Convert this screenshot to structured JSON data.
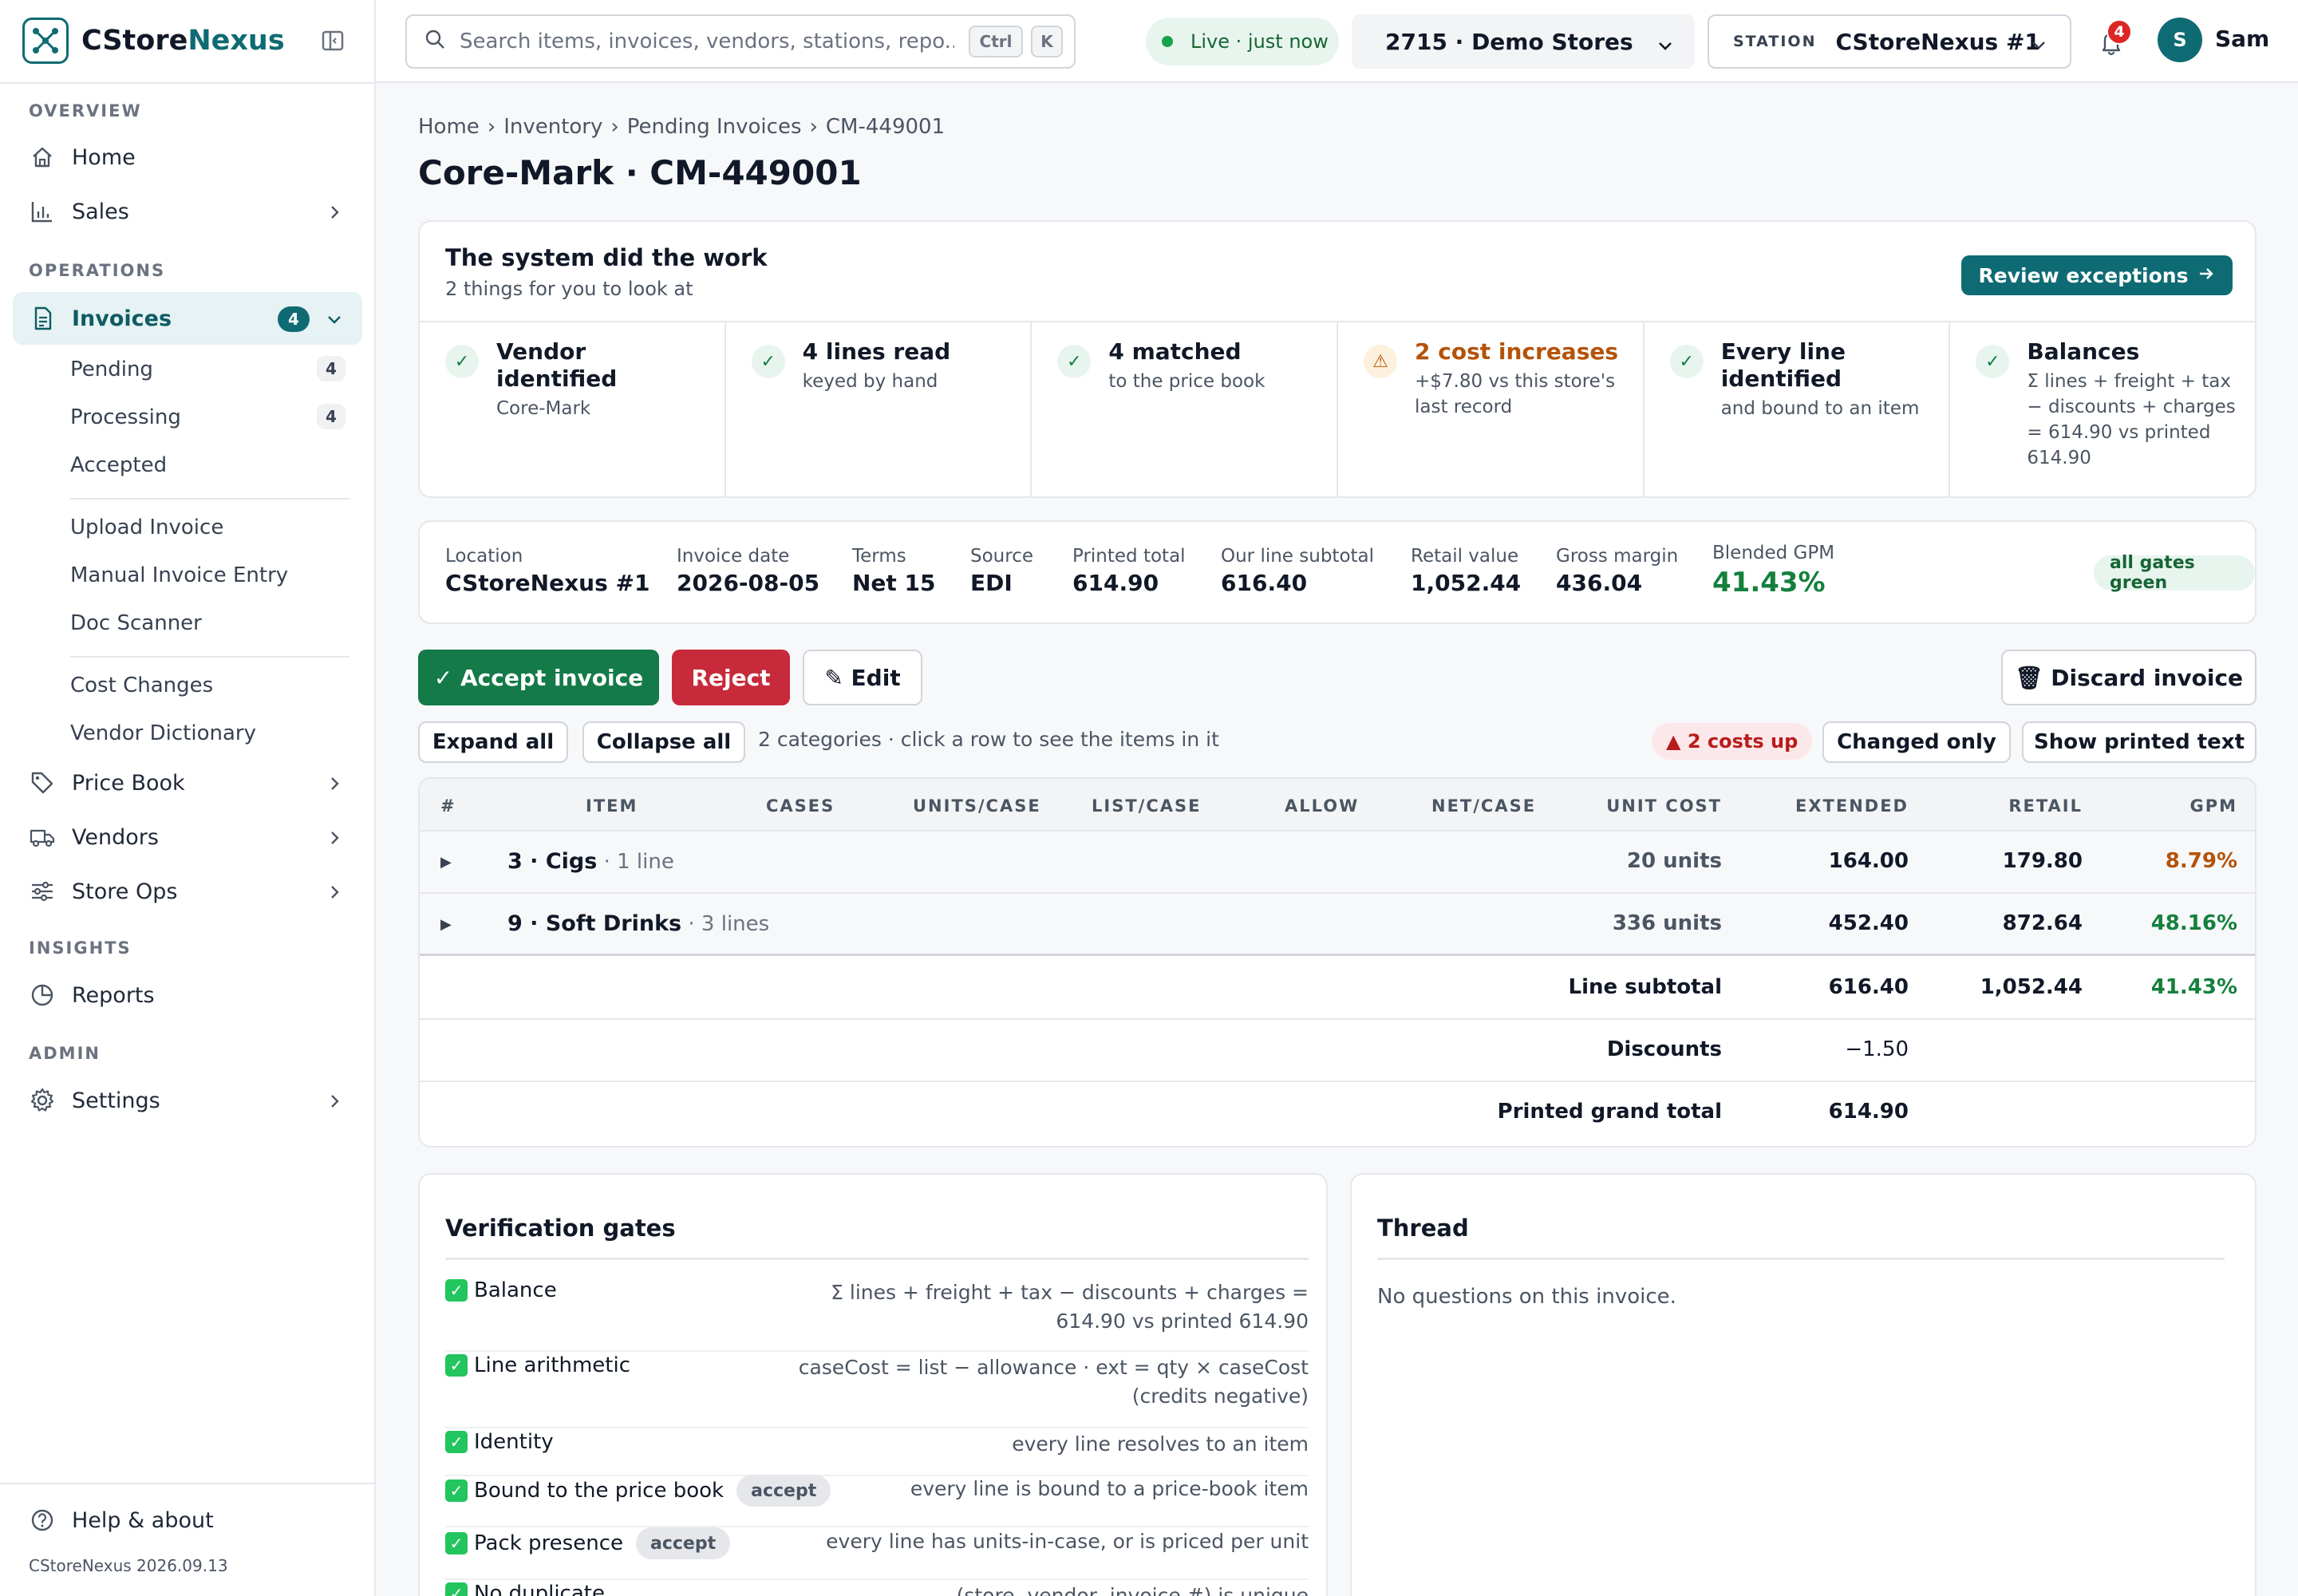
{
  "app": {
    "brand_prefix": "CStore",
    "brand_accent": "Nexus",
    "version": "CStoreNexus 2026.09.13"
  },
  "sidebar": {
    "sections": {
      "overview": "OVERVIEW",
      "operations": "OPERATIONS",
      "insights": "INSIGHTS",
      "admin": "ADMIN"
    },
    "items": {
      "home": "Home",
      "sales": "Sales",
      "invoices": "Invoices",
      "invoices_badge": "4",
      "price_book": "Price Book",
      "vendors": "Vendors",
      "store_ops": "Store Ops",
      "reports": "Reports",
      "settings": "Settings",
      "help": "Help & about"
    },
    "invoice_sub": {
      "pending": "Pending",
      "pending_badge": "4",
      "processing": "Processing",
      "processing_badge": "4",
      "accepted": "Accepted",
      "upload": "Upload Invoice",
      "manual": "Manual Invoice Entry",
      "scanner": "Doc Scanner",
      "cost_changes": "Cost Changes",
      "vendor_dictionary": "Vendor Dictionary"
    }
  },
  "topbar": {
    "search_placeholder": "Search items, invoices, vendors, stations, repo...",
    "kbd_ctrl": "Ctrl",
    "kbd_k": "K",
    "live": "Live · just now",
    "store": "2715 · Demo Stores",
    "station_tag": "STATION",
    "station": "CStoreNexus #1",
    "notifications": "4",
    "avatar_initial": "S",
    "user": "Sam"
  },
  "breadcrumb": [
    "Home",
    "›",
    "Inventory",
    "›",
    "Pending Invoices",
    "›",
    "CM-449001"
  ],
  "page_title": "Core-Mark · CM-449001",
  "summary": {
    "title": "The system did the work",
    "subtitle": "2 things for you to look at",
    "review_button": "Review exceptions",
    "tiles": [
      {
        "title": "Vendor identified",
        "sub": "Core-Mark",
        "status": "ok"
      },
      {
        "title": "4 lines read",
        "sub": "keyed by hand",
        "status": "ok"
      },
      {
        "title": "4 matched",
        "sub": "to the price book",
        "status": "ok"
      },
      {
        "title": "2 cost increases",
        "sub": "+$7.80 vs this store's last record",
        "status": "warn"
      },
      {
        "title": "Every line identified",
        "sub": "and bound to an item",
        "status": "ok"
      },
      {
        "title": "Balances",
        "sub": "Σ lines + freight + tax − discounts + charges = 614.90 vs printed 614.90",
        "status": "ok"
      }
    ]
  },
  "meta": {
    "location_label": "Location",
    "location": "CStoreNexus #1",
    "date_label": "Invoice date",
    "date": "2026-08-05",
    "terms_label": "Terms",
    "terms": "Net 15",
    "source_label": "Source",
    "source": "EDI",
    "printed_label": "Printed total",
    "printed": "614.90",
    "subtotal_label": "Our line subtotal",
    "subtotal": "616.40",
    "retail_label": "Retail value",
    "retail": "1,052.44",
    "margin_label": "Gross margin",
    "margin": "436.04",
    "gpm_label": "Blended GPM",
    "gpm": "41.43%",
    "gates_pill": "all gates green"
  },
  "actions": {
    "accept": "✓ Accept invoice",
    "reject": "Reject",
    "edit": "✎ Edit",
    "discard": "🗑 Discard invoice"
  },
  "toolbar": {
    "expand": "Expand all",
    "collapse": "Collapse all",
    "note": "2 categories · click a row to see the items in it",
    "costs_up": "▲ 2 costs up",
    "changed_only": "Changed only",
    "show_printed": "Show printed text"
  },
  "table": {
    "headers": [
      "#",
      "ITEM",
      "CASES",
      "UNITS/CASE",
      "LIST/CASE",
      "ALLOW",
      "NET/CASE",
      "UNIT COST",
      "EXTENDED",
      "RETAIL",
      "GPM"
    ],
    "rows": [
      {
        "name": "3 · Cigs",
        "lines": " · 1 line",
        "units": "20 units",
        "extended": "164.00",
        "retail": "179.80",
        "gpm": "8.79%"
      },
      {
        "name": "9 · Soft Drinks",
        "lines": " · 3 lines",
        "units": "336 units",
        "extended": "452.40",
        "retail": "872.64",
        "gpm": "48.16%"
      }
    ],
    "subtotal_label": "Line subtotal",
    "subtotal_ext": "616.40",
    "subtotal_retail": "1,052.44",
    "subtotal_gpm": "41.43%",
    "discounts_label": "Discounts",
    "discounts": "−1.50",
    "grand_label": "Printed grand total",
    "grand": "614.90"
  },
  "verification": {
    "title": "Verification gates",
    "gates": [
      {
        "name": "Balance",
        "desc1": "Σ lines + freight + tax − discounts + charges =",
        "desc2": "614.90 vs printed 614.90"
      },
      {
        "name": "Line arithmetic",
        "desc1": "caseCost = list − allowance · ext = qty × caseCost",
        "desc2": "(credits negative)"
      },
      {
        "name": "Identity",
        "desc1": "every line resolves to an item",
        "desc2": ""
      },
      {
        "name": "Bound to the price book",
        "pill": "accept",
        "desc1": "every line is bound to a price-book item",
        "desc2": ""
      },
      {
        "name": "Pack presence",
        "pill": "accept",
        "desc1": "every line has units-in-case, or is priced per unit",
        "desc2": ""
      },
      {
        "name": "No duplicate",
        "desc1": "(store, vendor, invoice #) is unique",
        "desc2": ""
      }
    ]
  },
  "thread": {
    "title": "Thread",
    "empty": "No questions on this invoice."
  },
  "colors": {
    "brand": "#0f6b73",
    "success": "#137a48",
    "danger": "#c72a3b",
    "warning": "#b45309"
  }
}
